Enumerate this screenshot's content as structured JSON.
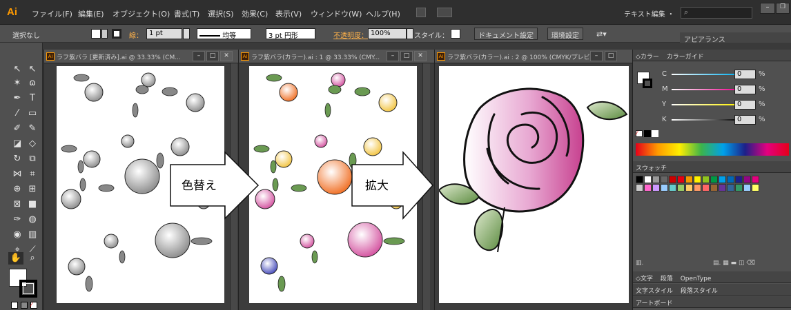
{
  "app": {
    "logo": "Ai",
    "search_placeholder": ""
  },
  "menu": [
    "ファイル(F)",
    "編集(E)",
    "オブジェクト(O)",
    "書式(T)",
    "選択(S)",
    "効果(C)",
    "表示(V)",
    "ウィンドウ(W)",
    "ヘルプ(H)"
  ],
  "workspace": "テキスト編集 ・",
  "control": {
    "selection": "選択なし",
    "stroke_label": "線：",
    "stroke_weight": "1 pt",
    "profile": "均等",
    "brush": "3 pt 円形",
    "opacity_label": "不透明度：",
    "opacity": "100%",
    "style_label": "スタイル：",
    "doc_setup": "ドキュメント設定",
    "prefs": "環境設定",
    "appearance_tab": "アピアランス"
  },
  "documents": [
    {
      "title": "ラフ紫バラ [更新済み].ai @ 33.33% (CM..."
    },
    {
      "title": "ラフ紫バラ(カラー).ai : 1 @ 33.33% (CMY..."
    },
    {
      "title": "ラフ紫バラ(カラー).ai : 2 @ 100% (CMYK/プレビュ..."
    }
  ],
  "arrows": [
    {
      "label": "色替え"
    },
    {
      "label": "拡大"
    }
  ],
  "panels": {
    "color_tabs": [
      "◇カラー",
      "カラーガイド"
    ],
    "cmyk": [
      {
        "label": "C",
        "value": "0",
        "color": "#00aeef"
      },
      {
        "label": "M",
        "value": "0",
        "color": "#ec008c"
      },
      {
        "label": "Y",
        "value": "0",
        "color": "#fff200"
      },
      {
        "label": "K",
        "value": "0",
        "color": "#000000"
      }
    ],
    "percent": "%",
    "swatches_tab": "スウォッチ",
    "swatch_colors": [
      "#000",
      "#fff",
      "#999",
      "#666",
      "#c00",
      "#e60012",
      "#f39800",
      "#fff100",
      "#8fc31f",
      "#009944",
      "#00a0e9",
      "#0068b7",
      "#1d2088",
      "#920783",
      "#e4007f",
      "#cccccc",
      "#ff66cc",
      "#cc99ff",
      "#99ccff",
      "#66cccc",
      "#99cc66",
      "#ffcc66",
      "#ff9966",
      "#ff6666",
      "#996633",
      "#663399",
      "#336699",
      "#339966",
      "#99ccff",
      "#ffff66"
    ],
    "text_tabs": [
      "◇文字",
      "段落",
      "OpenType"
    ],
    "style_tabs": [
      "文字スタイル",
      "段落スタイル"
    ],
    "artboard_tab": "アートボード"
  }
}
